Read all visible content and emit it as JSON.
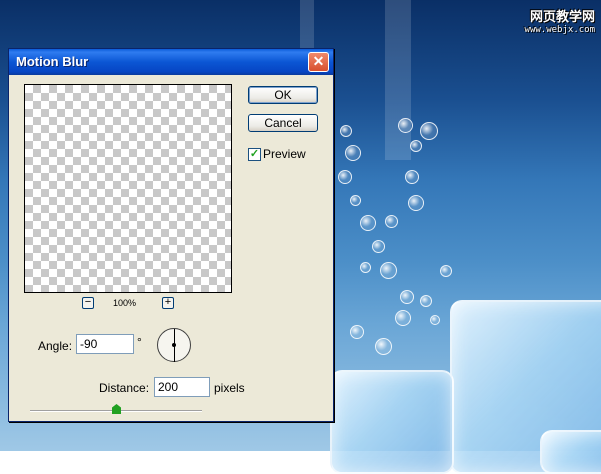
{
  "watermark": {
    "line1": "网页教学网",
    "line2": "www.webjx.com"
  },
  "dialog": {
    "title": "Motion Blur",
    "close_glyph": "✕",
    "ok_label": "OK",
    "cancel_label": "Cancel",
    "preview_label": "Preview",
    "preview_checked": true,
    "zoom": {
      "value": "100%",
      "minus": "−",
      "plus": "+"
    },
    "angle": {
      "label": "Angle:",
      "value": "-90",
      "unit": "°"
    },
    "distance": {
      "label": "Distance:",
      "value": "200",
      "unit": "pixels",
      "slider_fraction": 0.5
    }
  },
  "colors": {
    "titlebar": "#0a5bd8",
    "dialog_bg": "#ece9d8",
    "slider_thumb": "#21a121"
  }
}
